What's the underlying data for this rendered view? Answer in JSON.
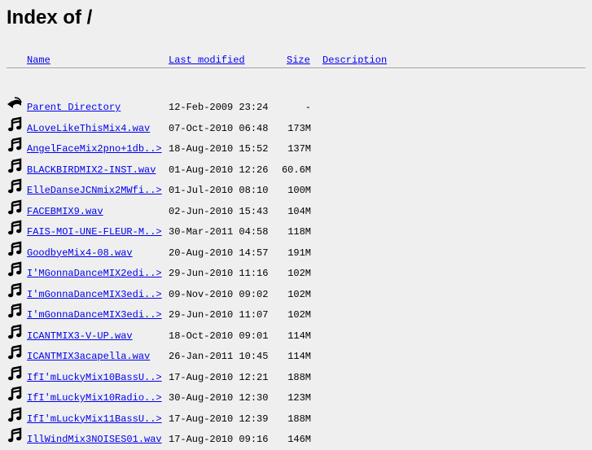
{
  "title": "Index of /",
  "columns": {
    "name": "Name",
    "modified": "Last modified",
    "size": "Size",
    "description": "Description"
  },
  "rows": [
    {
      "name": "Parent Directory",
      "modified": "12-Feb-2009 23:24",
      "size": "-",
      "icon": "back-icon"
    },
    {
      "name": "ALoveLikeThisMix4.wav",
      "modified": "07-Oct-2010 06:48",
      "size": "173M",
      "icon": "sound-icon"
    },
    {
      "name": "AngelFaceMix2pno+1db..>",
      "modified": "18-Aug-2010 15:52",
      "size": "137M",
      "icon": "sound-icon"
    },
    {
      "name": "BLACKBIRDMIX2-INST.wav",
      "modified": "01-Aug-2010 12:26",
      "size": "60.6M",
      "icon": "sound-icon"
    },
    {
      "name": "ElleDanseJCNmix2MWfi..>",
      "modified": "01-Jul-2010 08:10",
      "size": "100M",
      "icon": "sound-icon"
    },
    {
      "name": "FACEBMIX9.wav",
      "modified": "02-Jun-2010 15:43",
      "size": "104M",
      "icon": "sound-icon"
    },
    {
      "name": "FAIS-MOI-UNE-FLEUR-M..>",
      "modified": "30-Mar-2011 04:58",
      "size": "118M",
      "icon": "sound-icon"
    },
    {
      "name": "GoodbyeMix4-08.wav",
      "modified": "20-Aug-2010 14:57",
      "size": "191M",
      "icon": "sound-icon"
    },
    {
      "name": "I'MGonnaDanceMIX2edi..>",
      "modified": "29-Jun-2010 11:16",
      "size": "102M",
      "icon": "sound-icon"
    },
    {
      "name": "I'mGonnaDanceMIX3edi..>",
      "modified": "09-Nov-2010 09:02",
      "size": "102M",
      "icon": "sound-icon"
    },
    {
      "name": "I'mGonnaDanceMIX3edi..>",
      "modified": "29-Jun-2010 11:07",
      "size": "102M",
      "icon": "sound-icon"
    },
    {
      "name": "ICANTMIX3-V-UP.wav",
      "modified": "18-Oct-2010 09:01",
      "size": "114M",
      "icon": "sound-icon"
    },
    {
      "name": "ICANTMIX3acapella.wav",
      "modified": "26-Jan-2011 10:45",
      "size": "114M",
      "icon": "sound-icon"
    },
    {
      "name": "IfI'mLuckyMix10BassU..>",
      "modified": "17-Aug-2010 12:21",
      "size": "188M",
      "icon": "sound-icon"
    },
    {
      "name": "IfI'mLuckyMix10Radio..>",
      "modified": "30-Aug-2010 12:30",
      "size": "123M",
      "icon": "sound-icon"
    },
    {
      "name": "IfI'mLuckyMix11BassU..>",
      "modified": "17-Aug-2010 12:39",
      "size": "188M",
      "icon": "sound-icon"
    },
    {
      "name": "IllWindMix3NOISES01.wav",
      "modified": "17-Aug-2010 09:16",
      "size": "146M",
      "icon": "sound-icon"
    }
  ]
}
